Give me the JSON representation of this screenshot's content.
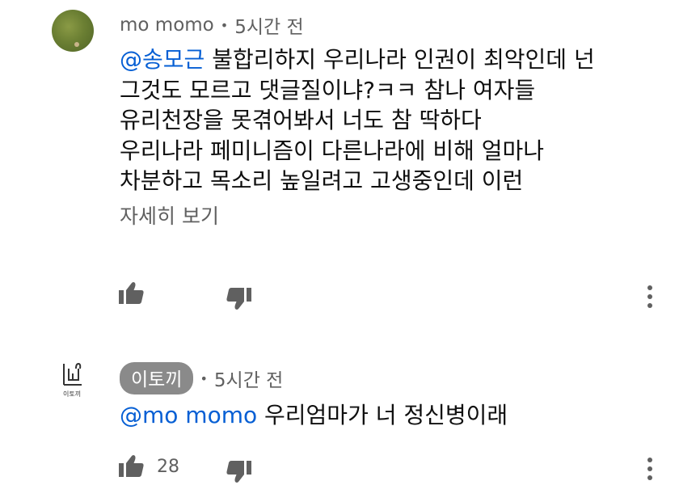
{
  "comments": [
    {
      "author": "mo momo",
      "time": "5시간 전",
      "mention": "@송모근",
      "lines": [
        "불합리하지 우리나라 인권이 최악인데 넌",
        "그것도 모르고 댓글질이냐?ㅋㅋ 참나 여자들",
        "유리천장을 못겪어봐서 너도 참 딱하다",
        "우리나라 페미니즘이 다른나라에 비해 얼마나",
        "차분하고 목소리 높일려고 고생중인데 이런"
      ],
      "read_more": "자세히 보기",
      "like_count": "",
      "avatar_icon": "grass-photo-avatar",
      "like_icon": "thumbs-up-icon",
      "dislike_icon": "thumbs-down-icon",
      "more_icon": "kebab-menu-icon"
    },
    {
      "author": "이토끼",
      "time": "5시간 전",
      "mention": "@mo momo",
      "text": "우리엄마가 너 정신병이래",
      "like_count": "28",
      "avatar_caption": "이토끼",
      "avatar_icon": "rabbit-logo-avatar",
      "like_icon": "thumbs-up-icon",
      "dislike_icon": "thumbs-down-icon",
      "more_icon": "kebab-menu-icon"
    }
  ],
  "colors": {
    "mention": "#065fd4",
    "text": "#0f0f0f",
    "secondary": "#606060",
    "chip": "#8a8a8a"
  }
}
